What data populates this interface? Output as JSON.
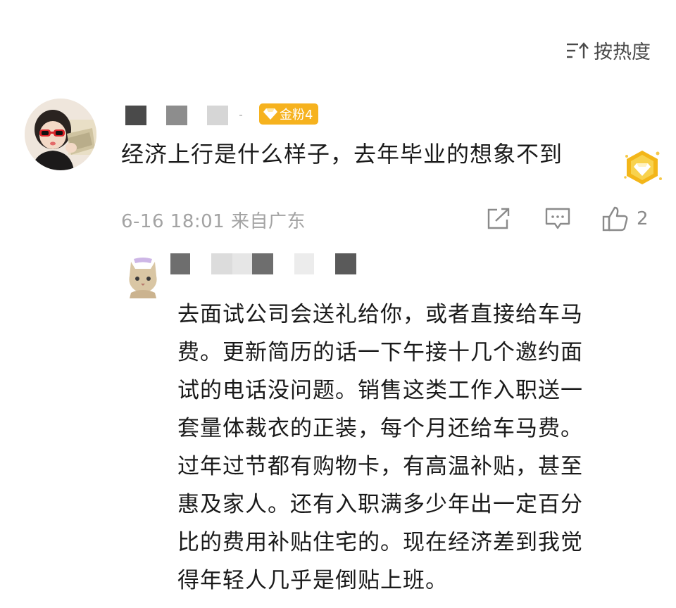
{
  "sort": {
    "label": "按热度",
    "icon": "sort-lines-icon"
  },
  "comment": {
    "avatar": "user-avatar-girl-sunglasses",
    "badge": {
      "icon": "gem-icon",
      "label": "金粉4"
    },
    "text": "经济上行是什么样子，去年毕业的想象不到",
    "medal": "gold-medal-icon",
    "meta": "6-16 18:01 来自广东",
    "actions": {
      "share": "share-icon",
      "reply": "comment-icon",
      "like": "thumbs-up-icon",
      "like_count": "2"
    }
  },
  "reply": {
    "avatar": "cat-avatar",
    "lines": [
      "去面试公司会送礼给你，或者直接给车马",
      "费。更新简历的话一下午接十几个邀约面",
      "试的电话没问题。销售这类工作入职送一",
      "套量体裁衣的正装，每个月还给车马费。",
      "过年过节都有购物卡，有高温补贴，甚至",
      "惠及家人。还有入职满多少年出一定百分",
      "比的费用补贴住宅的。现在经济差到我觉",
      "得年轻人几乎是倒贴上班。"
    ]
  },
  "colors": {
    "badge": "#f6b21e",
    "meta_text": "#a3a3a3",
    "body_text": "#1a1a1a",
    "icon_gray": "#8a8a8a"
  }
}
